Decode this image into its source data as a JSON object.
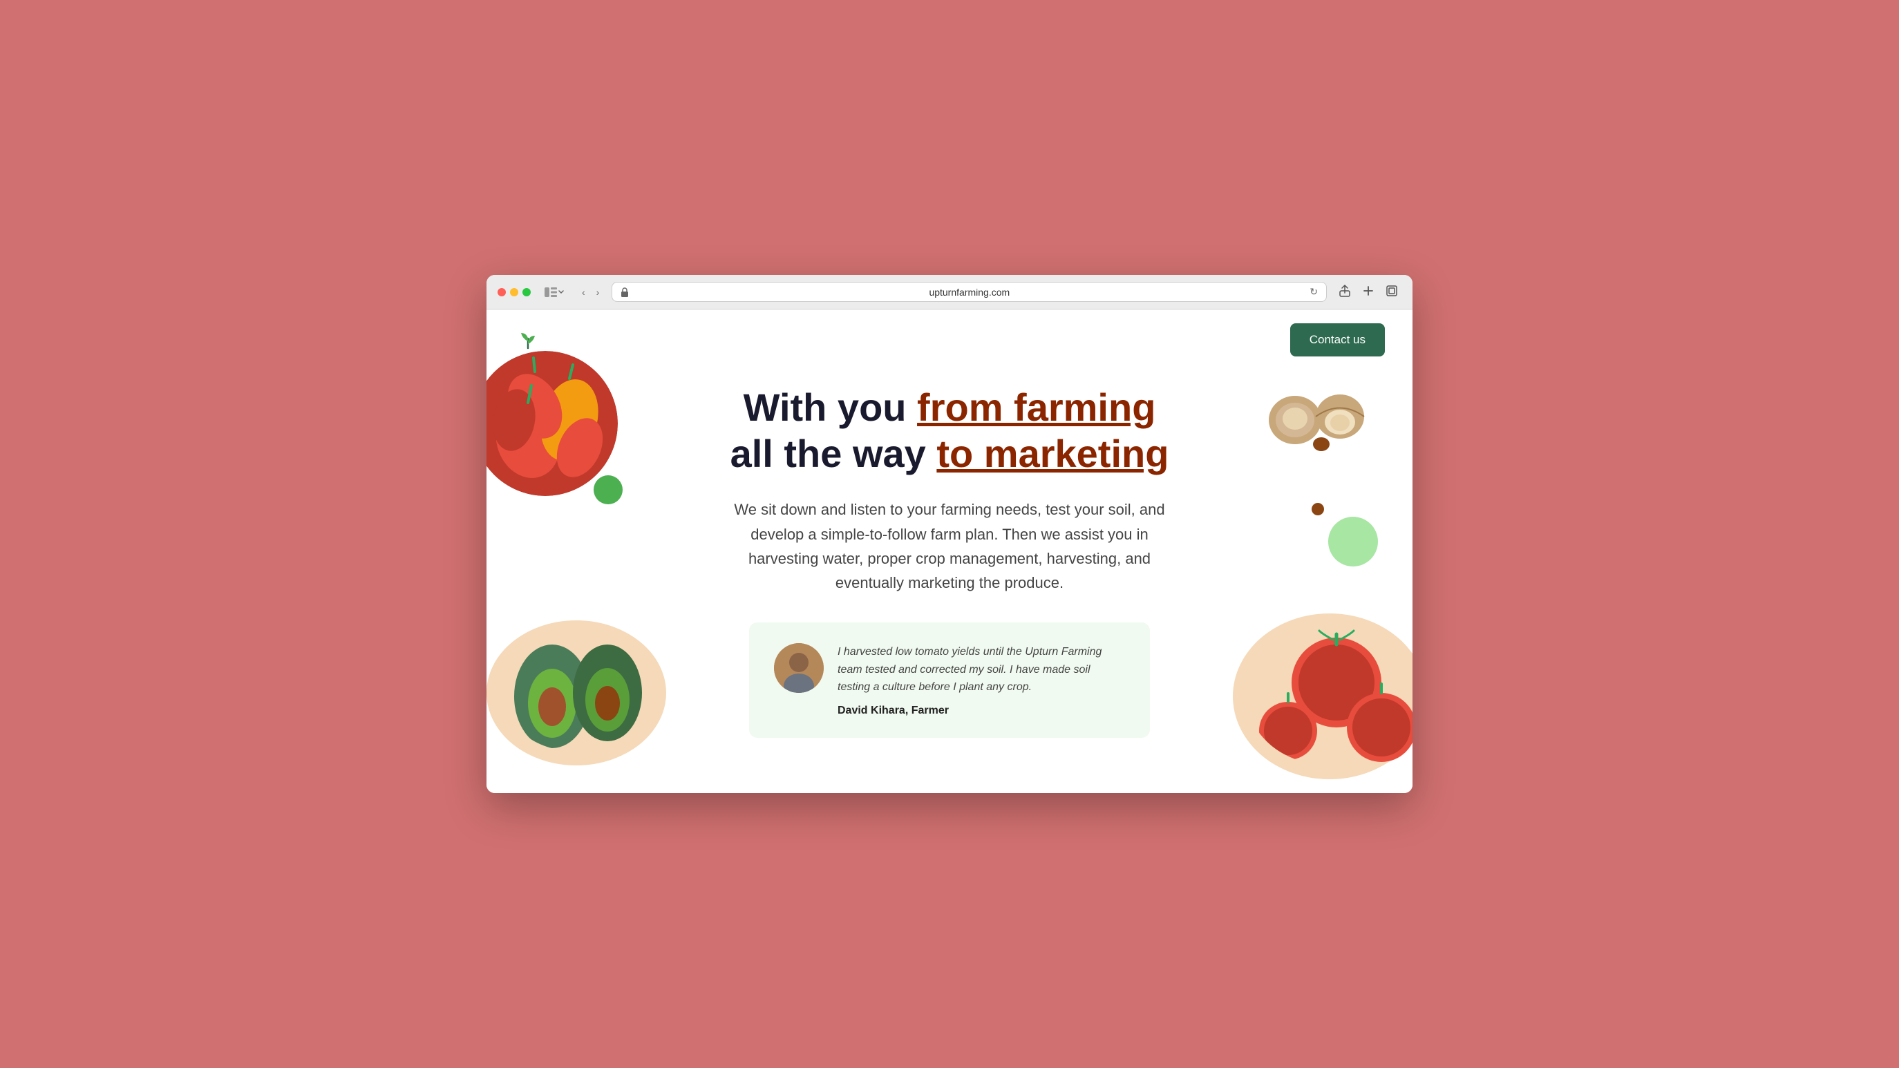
{
  "browser": {
    "url": "upturnfarming.com",
    "back_label": "‹",
    "forward_label": "›",
    "reload_label": "↻"
  },
  "nav": {
    "logo_alt": "Upturn Farming logo",
    "contact_button": "Contact us"
  },
  "hero": {
    "title_part1": "With you ",
    "title_highlight1": "from farming",
    "title_part2": "all the way ",
    "title_highlight2": "to marketing",
    "description": "We sit down and listen to your farming needs, test your soil, and develop a simple-to-follow farm plan. Then we assist you in harvesting water, proper crop management, harvesting, and eventually marketing the produce."
  },
  "testimonial": {
    "quote": "I harvested low tomato yields until the Upturn Farming team tested and corrected my soil. I have made soil testing a culture before I plant any crop.",
    "author": "David Kihara, Farmer"
  },
  "colors": {
    "green_dark": "#2d6a4f",
    "brown_highlight": "#8b2500",
    "green_dot": "#4caf50",
    "green_dot_light": "#a8e6a3",
    "card_bg": "#f0faf0"
  }
}
